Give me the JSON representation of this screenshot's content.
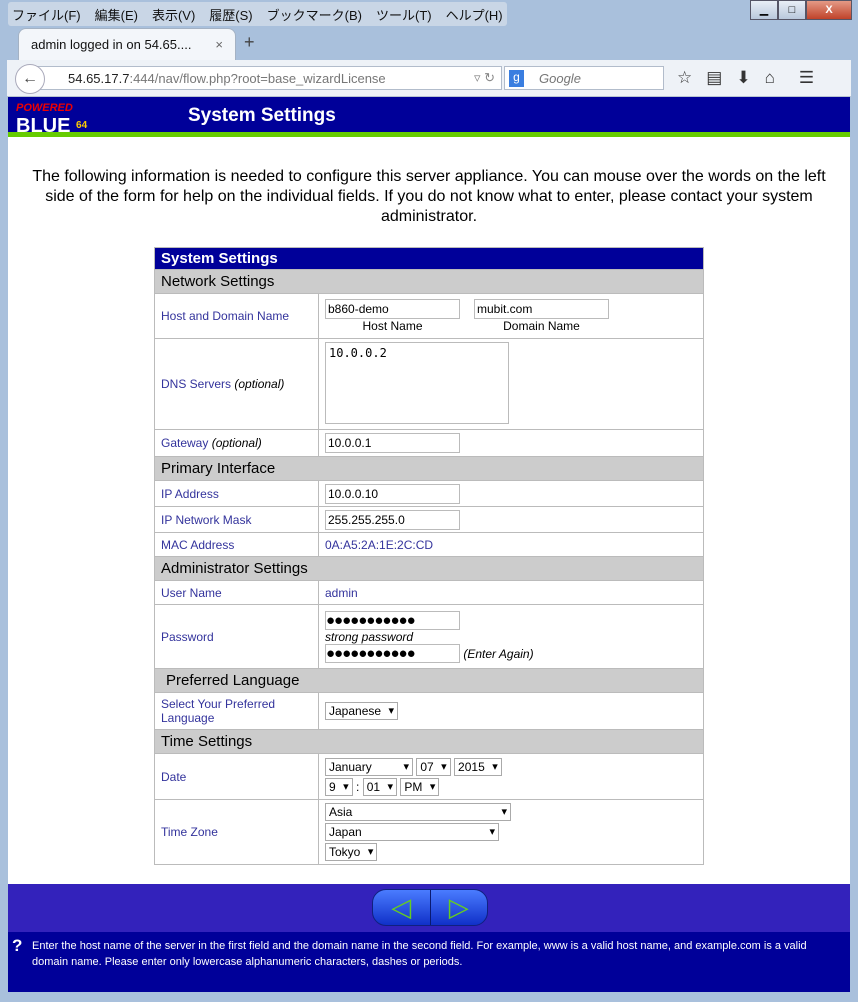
{
  "browser": {
    "menu": [
      "ファイル(F)",
      "編集(E)",
      "表示(V)",
      "履歴(S)",
      "ブックマーク(B)",
      "ツール(T)",
      "ヘルプ(H)"
    ],
    "tab_title": "admin logged in on 54.65....",
    "url_host": "54.65.17.7",
    "url_rest": ":444/nav/flow.php?root=base_wizardLicense",
    "search_placeholder": "Google"
  },
  "header": {
    "logo_top": "POWERED",
    "logo_main": "BLUE",
    "logo_sup": "64",
    "title": "System Settings"
  },
  "intro": "The following information is needed to configure this server appliance. You can mouse over the words on the left side of the form for help on the individual fields. If you do not know what to enter, please contact your system administrator.",
  "form": {
    "title": "System Settings",
    "network": {
      "heading": "Network Settings",
      "host_label": "Host and Domain Name",
      "host_value": "b860-demo",
      "domain_value": "mubit.com",
      "host_caption": "Host Name",
      "domain_caption": "Domain Name",
      "dns_label": "DNS Servers",
      "optional": "(optional)",
      "dns_value": "10.0.0.2",
      "gateway_label": "Gateway",
      "gateway_value": "10.0.0.1"
    },
    "primary": {
      "heading": "Primary Interface",
      "ip_label": "IP Address",
      "ip_value": "10.0.0.10",
      "mask_label": "IP Network Mask",
      "mask_value": "255.255.255.0",
      "mac_label": "MAC Address",
      "mac_value": "0A:A5:2A:1E:2C:CD"
    },
    "admin": {
      "heading": "Administrator Settings",
      "user_label": "User Name",
      "user_value": "admin",
      "password_label": "Password",
      "password_mask": "●●●●●●●●●●●",
      "strength": "strong password",
      "enter_again": "(Enter Again)"
    },
    "language": {
      "heading": "Preferred Language",
      "label": "Select Your Preferred Language",
      "value": "Japanese"
    },
    "time": {
      "heading": "Time Settings",
      "date_label": "Date",
      "month": "January",
      "day": "07",
      "year": "2015",
      "hour": "9",
      "minute": "01",
      "ampm": "PM",
      "tz_label": "Time Zone",
      "region": "Asia",
      "country": "Japan",
      "city": "Tokyo"
    }
  },
  "help": "Enter the host name of the server in the first field and the domain name in the second field. For example, www is a valid host name, and example.com is a valid domain name. Please enter only lowercase alphanumeric characters, dashes or periods."
}
